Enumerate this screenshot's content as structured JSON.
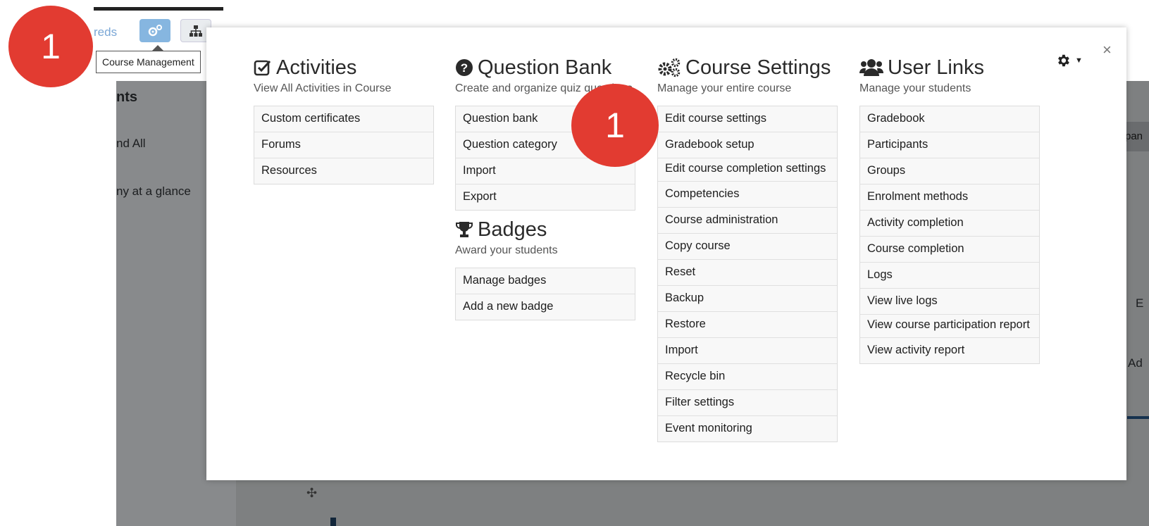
{
  "toolbar": {
    "partial_text": "reds",
    "tooltip": "Course Management"
  },
  "badges": {
    "step_left": "1",
    "step_center": "1"
  },
  "background": {
    "heading": "nts",
    "item1": "nd All",
    "item2": "ny at a glance",
    "right_tab": "pan",
    "right_e": "E",
    "right_ad": "Ad"
  },
  "modal": {
    "close": "×",
    "activities": {
      "title": "Activities",
      "subtitle": "View All Activities in Course",
      "items": [
        "Custom certificates",
        "Forums",
        "Resources"
      ]
    },
    "question_bank": {
      "title": "Question Bank",
      "subtitle": "Create and organize quiz questions",
      "items": [
        "Question bank",
        "Question category",
        "Import",
        "Export"
      ]
    },
    "badges": {
      "title": "Badges",
      "subtitle": "Award your students",
      "items": [
        "Manage badges",
        "Add a new badge"
      ]
    },
    "course_settings": {
      "title": "Course Settings",
      "subtitle": "Manage your entire course",
      "items": [
        "Edit course settings",
        "Gradebook setup",
        "Edit course completion settings",
        "Competencies",
        "Course administration",
        "Copy course",
        "Reset",
        "Backup",
        "Restore",
        "Import",
        "Recycle bin",
        "Filter settings",
        "Event monitoring"
      ]
    },
    "user_links": {
      "title": "User Links",
      "subtitle": "Manage your students",
      "items": [
        "Gradebook",
        "Participants",
        "Groups",
        "Enrolment methods",
        "Activity completion",
        "Course completion",
        "Logs",
        "View live logs",
        "View course participation report",
        "View activity report"
      ]
    }
  }
}
